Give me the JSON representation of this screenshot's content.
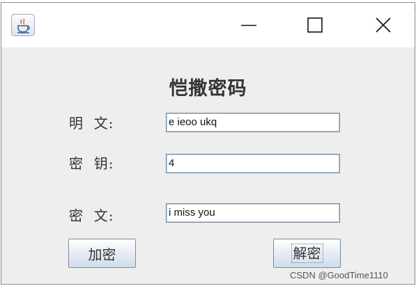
{
  "window": {
    "controls": {
      "minimize": "minimize-icon",
      "maximize": "maximize-icon",
      "close": "close-icon"
    },
    "app_icon": "java-icon"
  },
  "form": {
    "title": "恺撒密码",
    "plaintext_label": "明  文:",
    "plaintext_value": "e ieoo ukq",
    "key_label": "密  钥:",
    "key_value": "4",
    "ciphertext_label": "密  文:",
    "ciphertext_value": "i miss you",
    "encrypt_button": "加密",
    "decrypt_button": "解密"
  },
  "watermark": "CSDN @GoodTime1110",
  "colors": {
    "window_bg": "#eeeeee",
    "titlebar_bg": "#ffffff",
    "field_border": "#7a8a99",
    "text": "#333333"
  }
}
